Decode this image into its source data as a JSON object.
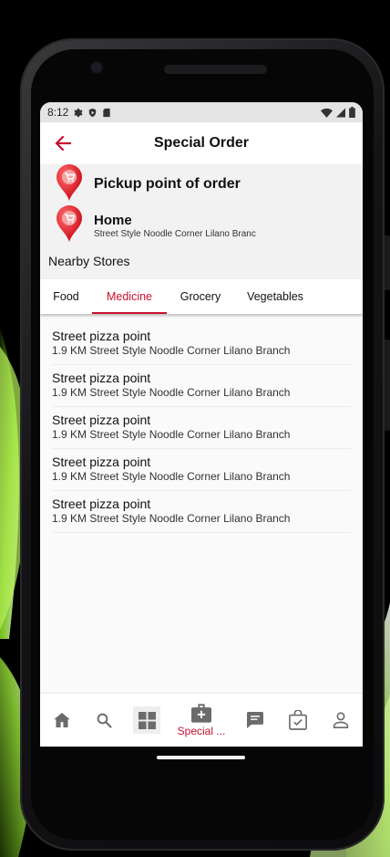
{
  "status_bar": {
    "time": "8:12",
    "icons_left": [
      "gear-icon",
      "play-protect-icon",
      "sd-card-icon"
    ],
    "icons_right": [
      "wifi-icon",
      "signal-icon",
      "battery-icon"
    ]
  },
  "app_bar": {
    "title": "Special Order",
    "back_icon": "arrow-left-icon"
  },
  "pickup": {
    "title": "Pickup point of order",
    "home_title": "Home",
    "home_address": "Street Style Noodle Corner Lilano Branc"
  },
  "nearby_label": "Nearby Stores",
  "tabs": [
    {
      "label": "Food",
      "active": false
    },
    {
      "label": "Medicine",
      "active": true
    },
    {
      "label": "Grocery",
      "active": false
    },
    {
      "label": "Vegetables",
      "active": false
    }
  ],
  "stores": [
    {
      "name": "Street pizza point",
      "detail": "1.9 KM Street Style Noodle Corner Lilano Branch"
    },
    {
      "name": "Street pizza point",
      "detail": "1.9 KM Street Style Noodle Corner Lilano Branch"
    },
    {
      "name": "Street pizza point",
      "detail": "1.9 KM Street Style Noodle Corner Lilano Branch"
    },
    {
      "name": "Street pizza point",
      "detail": "1.9 KM Street Style Noodle Corner Lilano Branch"
    },
    {
      "name": "Street pizza point",
      "detail": "1.9 KM Street Style Noodle Corner Lilano Branch"
    }
  ],
  "bottom_nav": {
    "special_label": "Special ...",
    "icons": [
      "home-icon",
      "search-icon",
      "grid-icon",
      "special-order-icon",
      "chat-icon",
      "bag-check-icon",
      "profile-icon"
    ]
  },
  "colors": {
    "accent": "#c8102e",
    "icon_gray": "#6b6b6b",
    "screen_bg": "#fafafa"
  }
}
